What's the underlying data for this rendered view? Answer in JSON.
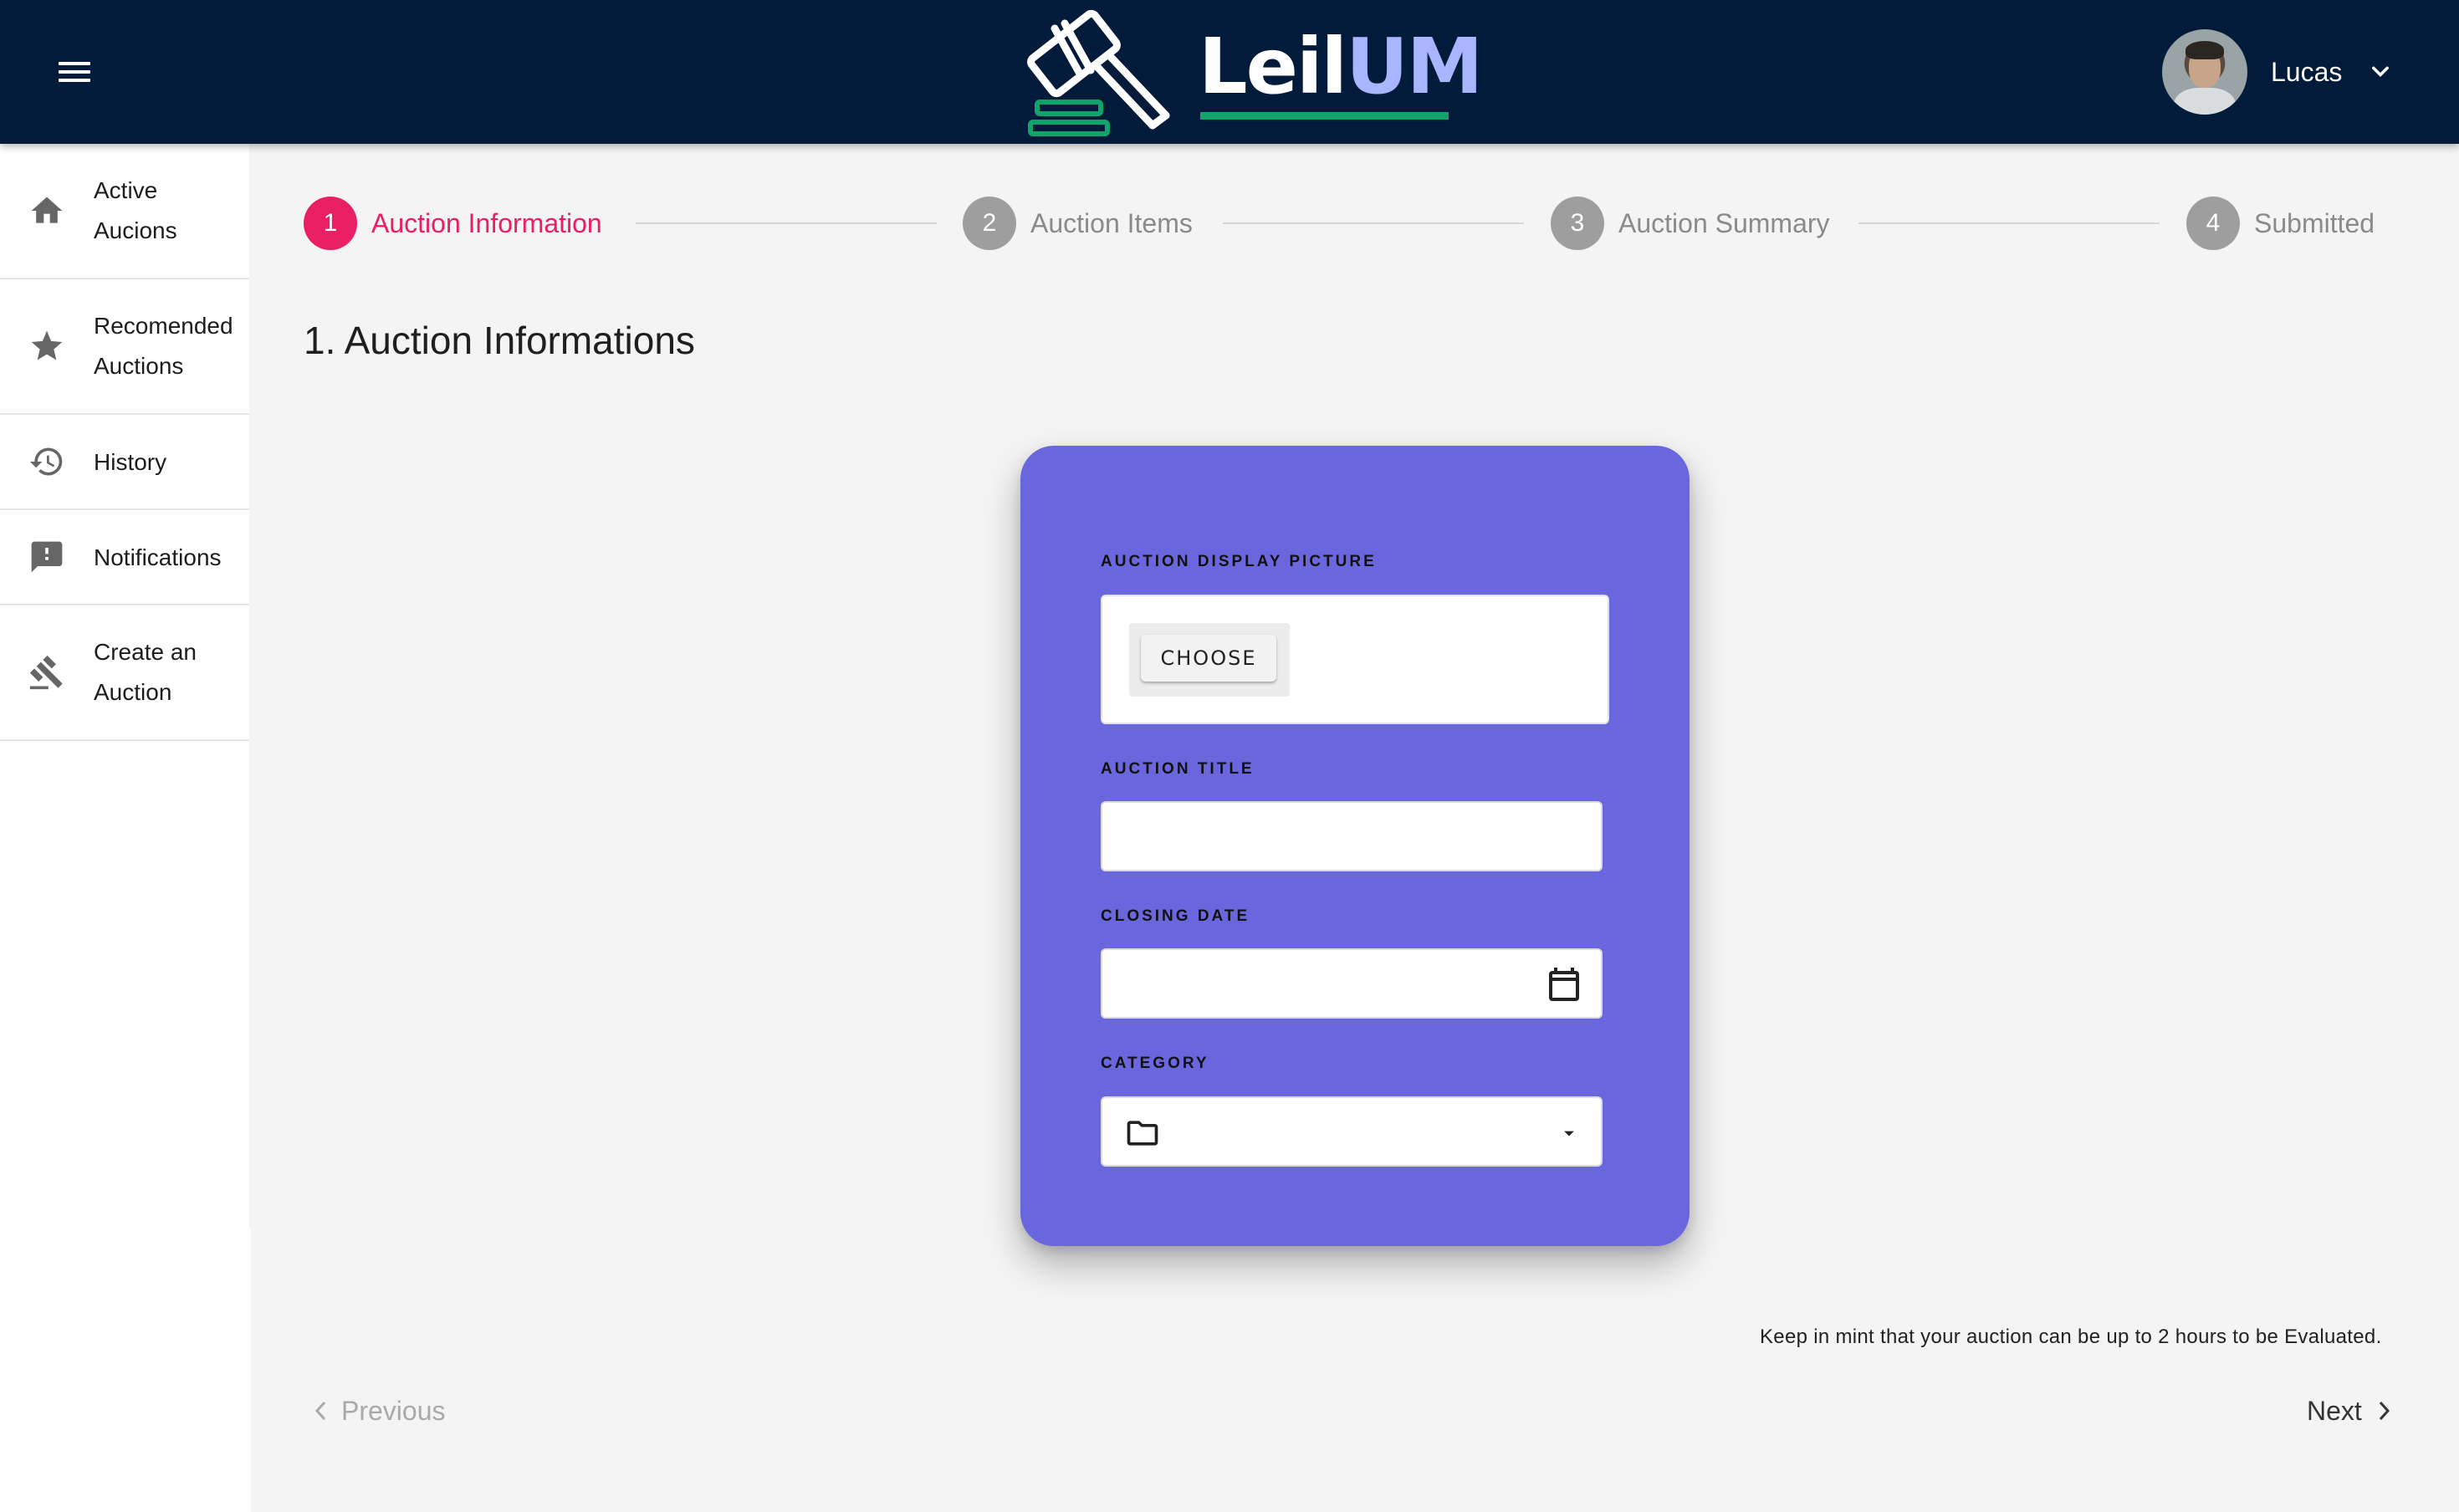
{
  "header": {
    "logo_part1": "Leil",
    "logo_part2": "UM",
    "user_name": "Lucas"
  },
  "sidebar": {
    "items": [
      {
        "line1": "Active",
        "line2": "Aucions",
        "icon": "home-icon"
      },
      {
        "line1": "Recomended",
        "line2": "Auctions",
        "icon": "star-icon"
      },
      {
        "line1": "History",
        "icon": "history-icon"
      },
      {
        "line1": "Notifications",
        "icon": "feedback-icon"
      },
      {
        "line1": "Create an",
        "line2": "Auction",
        "icon": "gavel-icon"
      }
    ]
  },
  "stepper": {
    "steps": [
      {
        "number": "1",
        "label": "Auction Information"
      },
      {
        "number": "2",
        "label": "Auction Items"
      },
      {
        "number": "3",
        "label": "Auction Summary"
      },
      {
        "number": "4",
        "label": "Submitted"
      }
    ],
    "active_step": 1,
    "active_color": "#e91e63"
  },
  "page": {
    "title": "1. Auction Informations"
  },
  "form": {
    "picture_label": "AUCTION DISPLAY PICTURE",
    "choose_label": "CHOOSE",
    "title_label": "AUCTION TITLE",
    "title_value": "",
    "closing_date_label": "CLOSING DATE",
    "closing_date_value": "",
    "category_label": "CATEGORY",
    "category_value": "",
    "card_color": "#6a66de"
  },
  "footer": {
    "note": "Keep in mint that your auction can be up to 2 hours to be Evaluated.",
    "previous_label": "Previous",
    "next_label": "Next"
  },
  "colors": {
    "header_bg": "#021b3a",
    "logo_accent": "#12a36a"
  }
}
